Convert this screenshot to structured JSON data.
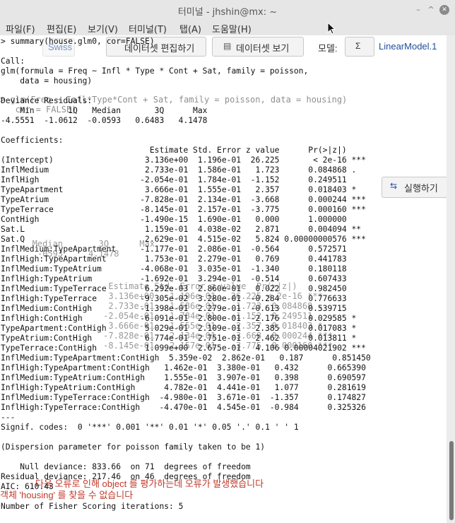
{
  "window": {
    "title": "터미널 - jhshin@mx: ~",
    "minimize": "–",
    "maximize": "^",
    "close": "✕"
  },
  "menu": [
    "파일(F)",
    "편집(E)",
    "보기(V)",
    "터미널(T)",
    "탭(A)",
    "도움말(H)"
  ],
  "background_app": {
    "toolbar_text": "Swiss",
    "edit_button": "데이터셋 편집하기",
    "view_button": "데이터셋 보기",
    "model_label": "모델:",
    "sigma_label": "Σ",
    "model_value": "LinearModel.1",
    "run_button": "실행하기",
    "error_line1": "다음 오류로 인해 object 를 평가하는데 오류가 발생했습니다",
    "error_line2": "객체 'housing' 를 찾을 수 없습니다",
    "code_fragment": "> glm(Freq ~ Infl*Type*Cont + Sat, family = poisson, data = housing)\n   cor = FALSE)",
    "residuals_fragment": "   Median       3Q      Max\n    -0593     4.1478",
    "coef_fragment": "      Estimate Std. Error z value  Pr(>|z|)\n      3.136e+00   1.196e-01   26.225 < 2e-16 ***\n      2.733e-01   1.586e-01    1.723  0.084868 .\n     -2.054e-01   1.784e-01   -1.152  0.249511\n      3.666e-01   1.555e-01    2.357  0.018403 *\n     -7.828e-01   2.134e-01   -3.668  0.000244 ***\n     -8.145e-01   2.157e-01   -3.775  0.000160 ***"
  },
  "terminal": {
    "output": "> summary(house.glm0, cor=FALSE)\n\nCall:\nglm(formula = Freq ~ Infl * Type * Cont + Sat, family = poisson,\n    data = housing)\n\nDeviance Residuals:\n    Min       1Q   Median       3Q      Max\n-4.5551  -1.0612  -0.0593   0.6483   4.1478\n\nCoefficients:\n                               Estimate Std. Error z value      Pr(>|z|)\n(Intercept)                   3.136e+00  1.196e-01  26.225       < 2e-16 ***\nInflMedium                    2.733e-01  1.586e-01   1.723      0.084868 .\nInflHigh                     -2.054e-01  1.784e-01  -1.152      0.249511\nTypeApartment                 3.666e-01  1.555e-01   2.357      0.018403 *\nTypeAtrium                   -7.828e-01  2.134e-01  -3.668      0.000244 ***\nTypeTerrace                  -8.145e-01  2.157e-01  -3.775      0.000160 ***\nContHigh                     -1.490e-15  1.690e-01   0.000      1.000000\nSat.L                         1.159e-01  4.038e-02   2.871      0.004094 **\nSat.Q                         2.629e-01  4.515e-02   5.824 0.00000000576 ***\nInflMedium:TypeApartment     -1.177e-01  2.086e-01  -0.564      0.572571\nInflHigh:TypeApartment        1.753e-01  2.279e-01   0.769      0.441783\nInflMedium:TypeAtrium        -4.068e-01  3.035e-01  -1.340      0.180118\nInflHigh:TypeAtrium          -1.692e-01  3.294e-01  -0.514      0.607433\nInflMedium:TypeTerrace        6.292e-03  2.860e-01   0.022      0.982450\nInflHigh:TypeTerrace         -9.305e-02  3.280e-01  -0.284      0.776633\nInflMedium:ContHigh          -1.398e-01  2.279e-01  -0.613      0.539715\nInflHigh:ContHigh            -6.091e-01  2.800e-01  -2.176      0.029585 *\nTypeApartment:ContHigh        5.029e-01  2.109e-01   2.385      0.017083 *\nTypeAtrium:ContHigh           6.774e-01  2.751e-01   2.462      0.013811 *\nTypeTerrace:ContHigh          1.099e+00  2.675e-01   4.106 0.00004021902 ***\nInflMedium:TypeApartment:ContHigh  5.359e-02  2.862e-01   0.187      0.851450\nInflHigh:TypeApartment:ContHigh   1.462e-01  3.380e-01   0.432      0.665390\nInflMedium:TypeAtrium:ContHigh    1.555e-01  3.907e-01   0.398      0.690597\nInflHigh:TypeAtrium:ContHigh      4.782e-01  4.441e-01   1.077      0.281619\nInflMedium:TypeTerrace:ContHigh  -4.980e-01  3.671e-01  -1.357      0.174827\nInflHigh:TypeTerrace:ContHigh    -4.470e-01  4.545e-01  -0.984      0.325326\n---\nSignif. codes:  0 '***' 0.001 '**' 0.01 '*' 0.05 '.' 0.1 ' ' 1\n\n(Dispersion parameter for poisson family taken to be 1)\n\n    Null deviance: 833.66  on 71  degrees of freedom\nResidual deviance: 217.46  on 46  degrees of freedom\nAIC: 610.43\n\nNumber of Fisher Scoring iterations: 5"
  },
  "colors": {
    "chrome": "#e6e6e6",
    "ghost_red": "#c0392b",
    "ghost_blue": "#1f4e9c"
  }
}
